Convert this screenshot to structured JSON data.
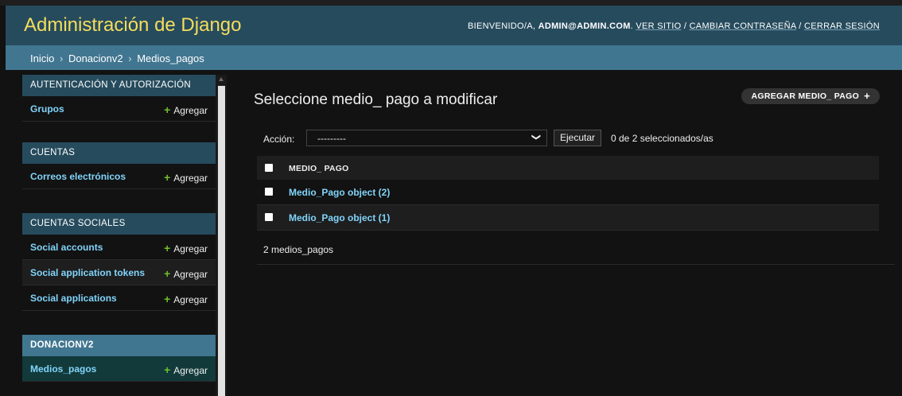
{
  "header": {
    "brand": "Administración de Django",
    "welcome": "BIENVENIDO/A,",
    "user": "ADMIN@ADMIN.COM",
    "links": [
      "VER SITIO",
      "CAMBIAR CONTRASEÑA",
      "CERRAR SESIÓN"
    ],
    "separator": " / "
  },
  "breadcrumbs": {
    "items": [
      "Inicio",
      "Donacionv2",
      "Medios_pagos"
    ],
    "separator": "›"
  },
  "sidebar": {
    "add_label": "Agregar",
    "modules": [
      {
        "caption": "AUTENTICACIÓN Y AUTORIZACIÓN",
        "models": [
          "Grupos"
        ]
      },
      {
        "caption": "CUENTAS",
        "models": [
          "Correos electrónicos"
        ]
      },
      {
        "caption": "CUENTAS SOCIALES",
        "models": [
          "Social accounts",
          "Social application tokens",
          "Social applications"
        ]
      },
      {
        "caption": "DONACIONV2",
        "models": [
          "Medios_pagos"
        ]
      }
    ]
  },
  "main": {
    "title": "Seleccione medio_ pago a modificar",
    "add_button": "AGREGAR MEDIO_ PAGO",
    "action_label": "Acción:",
    "action_value": "---------",
    "go_button": "Ejecutar",
    "selection_counter": "0 de 2 seleccionados/as",
    "column_header": "MEDIO_ PAGO",
    "rows": [
      "Medio_Pago object (2)",
      "Medio_Pago object (1)"
    ],
    "paginator": "2 medios_pagos"
  },
  "colors": {
    "header_bg": "#264b5d",
    "brand": "#f5dd5d",
    "breadcrumbs_bg": "#417690",
    "link": "#81d4fa",
    "add_plus": "#70bf2b",
    "current_row": "#123a3a"
  }
}
